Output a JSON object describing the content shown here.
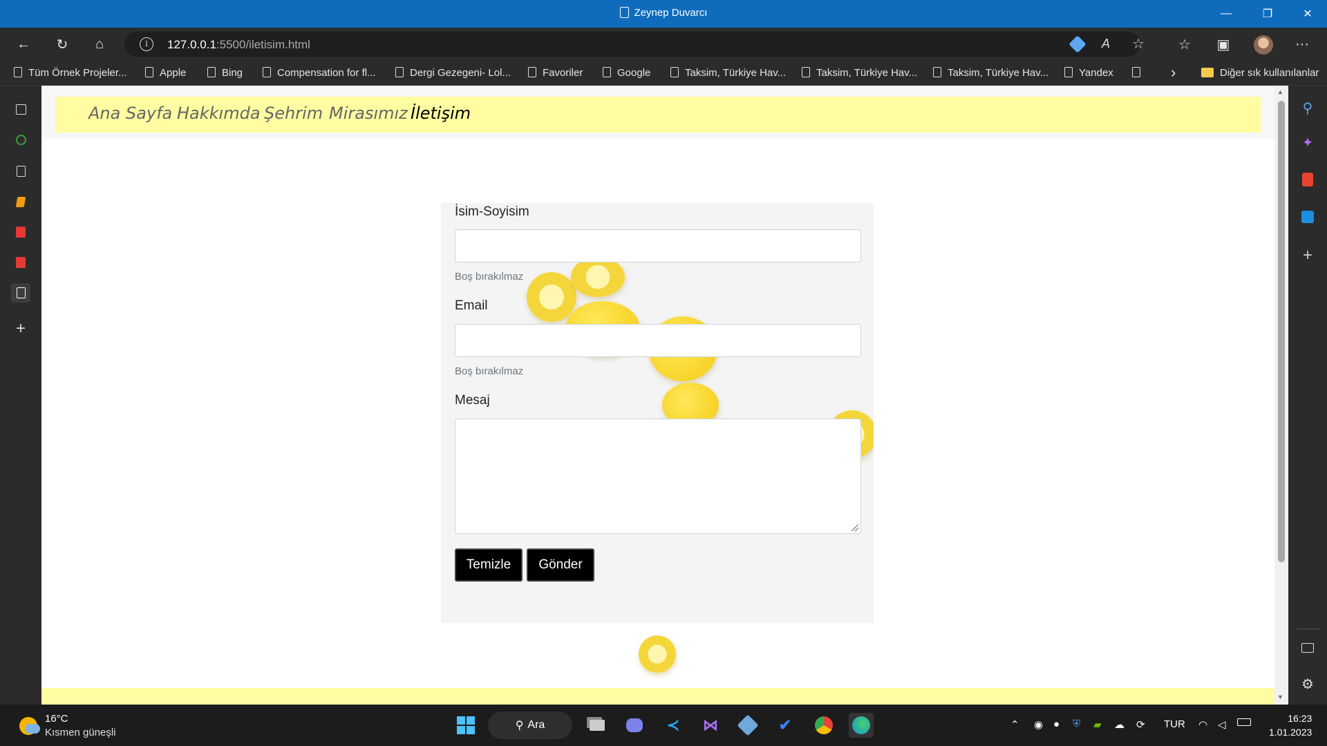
{
  "window": {
    "title": "Zeynep Duvarcı",
    "minimize_glyph": "—",
    "restore_glyph": "❐",
    "close_glyph": "✕"
  },
  "toolbar": {
    "back_icon": "←",
    "refresh_icon": "↻",
    "home_icon": "⌂",
    "info_icon": "i",
    "url_host": "127.0.0.1",
    "url_rest": ":5500/iletisim.html",
    "read_aloud_icon": "A",
    "favorite_add_icon": "☆",
    "favorites_icon": "☆",
    "collections_icon": "▣",
    "more_icon": "···"
  },
  "bookmarks": [
    {
      "label": "Tüm Örnek Projeler..."
    },
    {
      "label": "Apple"
    },
    {
      "label": "Bing"
    },
    {
      "label": "Compensation for fl..."
    },
    {
      "label": "Dergi Gezegeni- Lol..."
    },
    {
      "label": "Favoriler"
    },
    {
      "label": "Google"
    },
    {
      "label": "Taksim, Türkiye Hav..."
    },
    {
      "label": "Taksim, Türkiye Hav..."
    },
    {
      "label": "Taksim, Türkiye Hav..."
    },
    {
      "label": "Yandex"
    },
    {
      "label": ""
    }
  ],
  "bookmarks_overflow": "›",
  "other_favorites": "Diğer sık kullanılanlar",
  "page": {
    "nav": [
      "Ana Sayfa",
      "Hakkımda",
      "Şehrim",
      "Mirasımız",
      "İletişim"
    ],
    "active_nav": "İletişim",
    "form": {
      "name_label": "İsim-Soyisim",
      "name_help": "Boş bırakılmaz",
      "email_label": "Email",
      "email_help": "Boş bırakılmaz",
      "message_label": "Mesaj",
      "clear_button": "Temizle",
      "send_button": "Gönder"
    }
  },
  "taskbar": {
    "weather_temp": "16°C",
    "weather_condition": "Kısmen güneşli",
    "search_label": "Ara",
    "language": "TUR",
    "time": "16:23",
    "date": "1.01.2023"
  },
  "colors": {
    "title_bar": "#0f6cbd",
    "nav_background": "#fffca1",
    "button_background": "#000000"
  }
}
